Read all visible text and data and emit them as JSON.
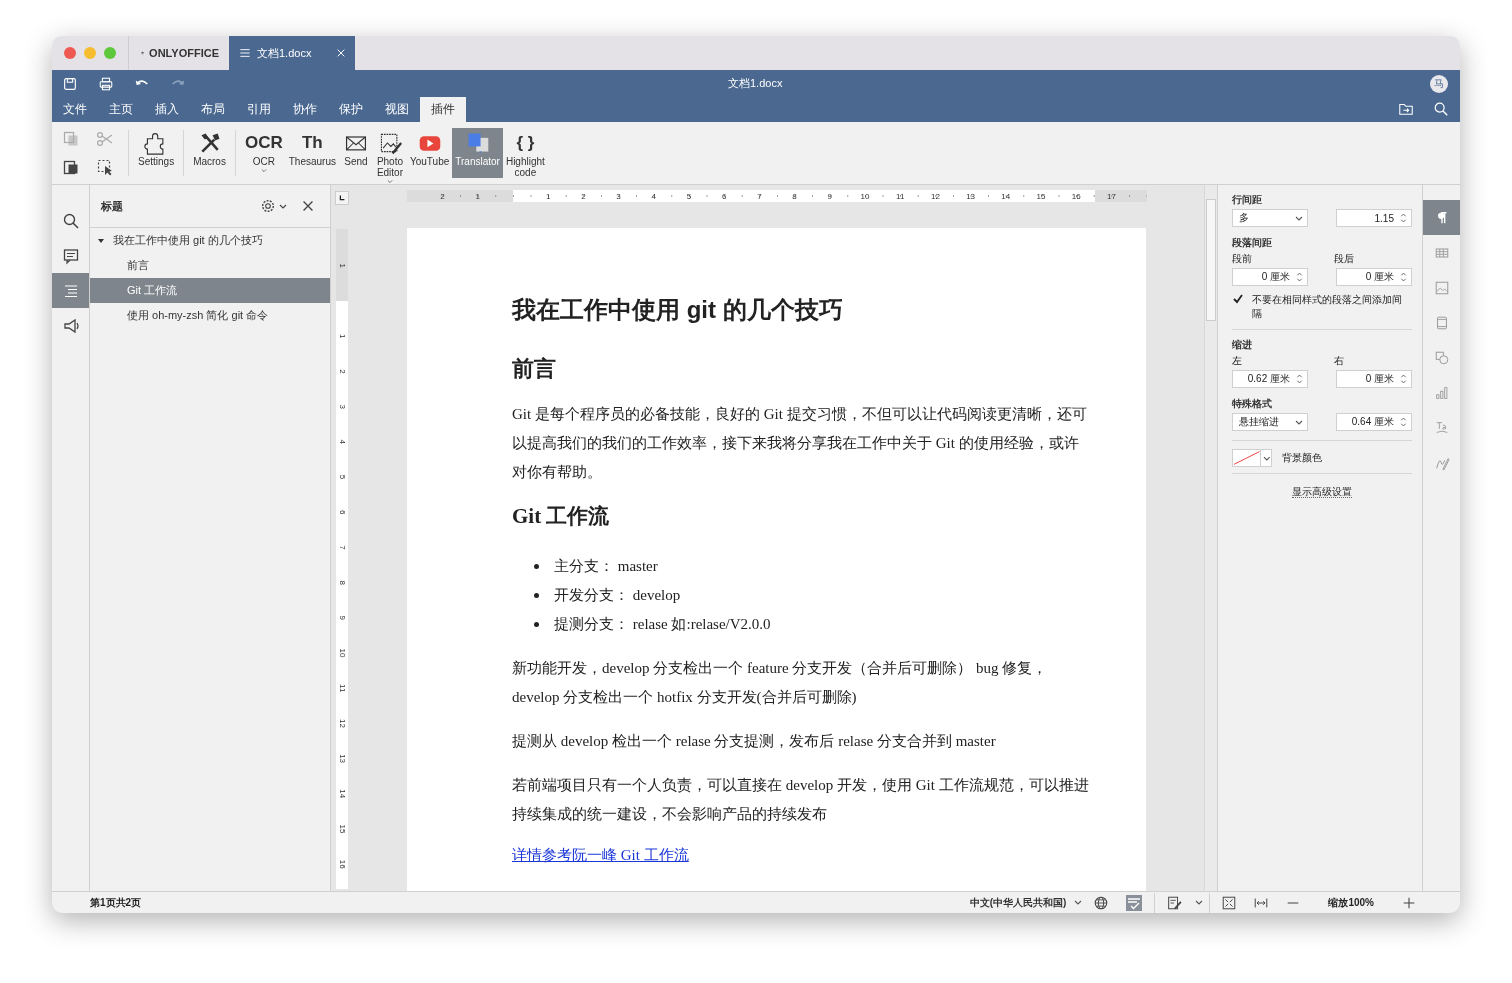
{
  "app_tab": {
    "label": "ONLYOFFICE"
  },
  "doc_tab": {
    "label": "文档1.docx"
  },
  "window": {
    "title": "文档1.docx",
    "user_initial": "马"
  },
  "quick_actions": [
    {
      "disabled": false
    },
    {
      "disabled": false
    },
    {
      "disabled": false
    },
    {
      "disabled": true
    }
  ],
  "menu_tabs": [
    {
      "label": "文件",
      "selected": false
    },
    {
      "label": "主页",
      "selected": false
    },
    {
      "label": "插入",
      "selected": false
    },
    {
      "label": "布局",
      "selected": false
    },
    {
      "label": "引用",
      "selected": false
    },
    {
      "label": "协作",
      "selected": false
    },
    {
      "label": "保护",
      "selected": false
    },
    {
      "label": "视图",
      "selected": false
    },
    {
      "label": "插件",
      "selected": true
    }
  ],
  "clipboard": [
    {
      "disabled": true
    },
    {
      "disabled": true
    },
    {
      "disabled": false
    },
    {
      "disabled": false
    }
  ],
  "plugins": [
    {
      "label": "Settings",
      "selected": false,
      "menu": false
    },
    {
      "label": "Macros",
      "selected": false,
      "menu": false
    },
    {
      "label": "OCR",
      "icon_text": "OCR",
      "selected": false,
      "menu": true
    },
    {
      "label": "Thesaurus",
      "icon_text": "Th",
      "selected": false,
      "menu": false
    },
    {
      "label": "Send",
      "selected": false,
      "menu": false
    },
    {
      "label": "Photo Editor",
      "selected": false,
      "menu": true
    },
    {
      "label": "YouTube",
      "selected": false,
      "menu": false
    },
    {
      "label": "Translator",
      "selected": true,
      "menu": false
    },
    {
      "label": "Highlight code",
      "icon_text": "{ }",
      "selected": false,
      "menu": false
    }
  ],
  "left_rail": [
    {
      "selected": false
    },
    {
      "selected": false
    },
    {
      "selected": true
    },
    {
      "selected": false
    }
  ],
  "navigation": {
    "title": "标题",
    "tree": [
      {
        "label": "我在工作中使用 git 的几个技巧",
        "expanded": true,
        "selected": false,
        "children": [
          {
            "label": "前言",
            "selected": false
          },
          {
            "label": "Git 工作流",
            "selected": true
          },
          {
            "label": "使用 oh-my-zsh 简化 git 命令",
            "selected": false
          }
        ]
      }
    ]
  },
  "ruler": {
    "left_margin_labels": [
      "2",
      "1"
    ],
    "body_labels": [
      "1",
      "2",
      "3",
      "4",
      "5",
      "6",
      "7",
      "8",
      "9",
      "10",
      "11",
      "12",
      "13",
      "14",
      "15",
      "16"
    ],
    "right_margin_labels": [
      "17"
    ],
    "top_margin_labels": [
      "1"
    ],
    "vertical_labels": [
      "1",
      "2",
      "3",
      "4",
      "5",
      "6",
      "7",
      "8",
      "9",
      "10",
      "11",
      "12",
      "13",
      "14",
      "15",
      "16"
    ]
  },
  "document": [
    {
      "kind": "title",
      "text": "我在工作中使用 git 的几个技巧"
    },
    {
      "kind": "h1",
      "text": "前言"
    },
    {
      "kind": "para",
      "text": "Git 是每个程序员的必备技能，良好的 Git 提交习惯，不但可以让代码阅读更清晰，还可以提高我们的我们的工作效率，接下来我将分享我在工作中关于 Git 的使用经验，或许对你有帮助。"
    },
    {
      "kind": "h2",
      "text": "Git 工作流"
    },
    {
      "kind": "bullets",
      "items": [
        "主分支： master",
        "开发分支： develop",
        "提测分支： relase 如:relase/V2.0.0"
      ]
    },
    {
      "kind": "para",
      "text": "新功能开发，develop 分支检出一个 feature 分支开发（合并后可删除） bug 修复，develop 分支检出一个 hotfix 分支开发(合并后可删除)"
    },
    {
      "kind": "para",
      "text": "提测从 develop 检出一个 relase 分支提测，发布后 relase 分支合并到 master"
    },
    {
      "kind": "para",
      "text": "若前端项目只有一个人负责，可以直接在 develop 开发，使用 Git 工作流规范，可以推进持续集成的统一建设，不会影响产品的持续发布"
    },
    {
      "kind": "link",
      "text": "详情参考阮一峰 Git 工作流"
    }
  ],
  "paragraph_settings": {
    "line_spacing": {
      "title": "行间距",
      "mode": "多",
      "value": "1.15"
    },
    "paragraph_spacing": {
      "title": "段落间距",
      "before_label": "段前",
      "before": "0 厘米",
      "after_label": "段后",
      "after": "0 厘米"
    },
    "no_space_same_style": {
      "label": "不要在相同样式的段落之间添加间隔",
      "checked": true
    },
    "indent": {
      "title": "缩进",
      "left_label": "左",
      "left": "0.62 厘米",
      "right_label": "右",
      "right": "0 厘米"
    },
    "special": {
      "title": "特殊格式",
      "mode": "悬挂缩进",
      "value": "0.64 厘米"
    },
    "background": {
      "label": "背景颜色"
    },
    "advanced_link": "显示高级设置"
  },
  "right_rail": [
    {
      "selected": true
    },
    {
      "selected": false
    },
    {
      "selected": false
    },
    {
      "selected": false
    },
    {
      "selected": false
    },
    {
      "selected": false
    },
    {
      "selected": false
    },
    {
      "selected": false
    }
  ],
  "status_bar": {
    "page": "第1页共2页",
    "language": "中文(中华人民共和国)",
    "spellcheck_on": true,
    "zoom": "缩放100%"
  }
}
